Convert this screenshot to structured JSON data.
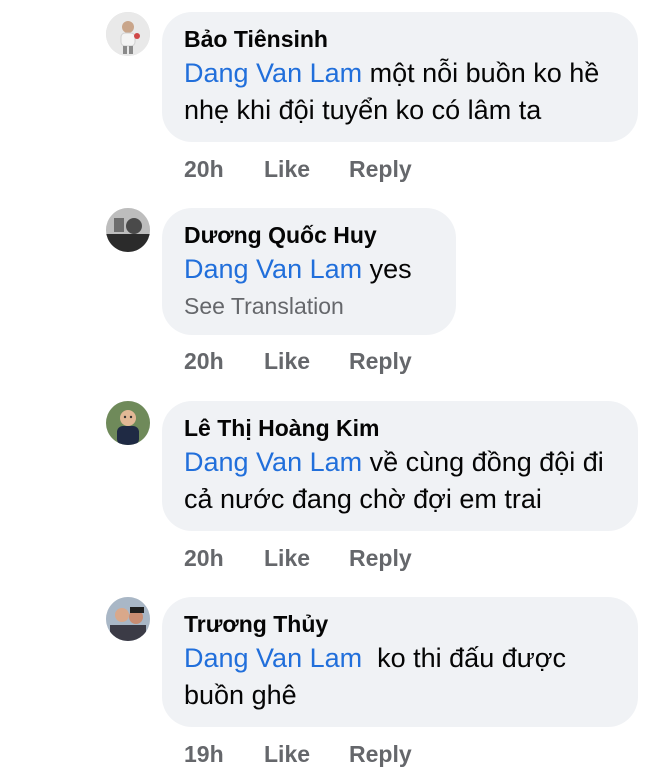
{
  "comments": [
    {
      "author": "Bảo Tiênsinh",
      "mention": "Dang Van Lam",
      "text": " một nỗi buồn ko hề nhẹ khi đội tuyển ko có lâm ta",
      "see_translation": "",
      "time": "20h",
      "like": "Like",
      "reply": "Reply"
    },
    {
      "author": "Dương Quốc Huy",
      "mention": "Dang Van Lam",
      "text": " yes",
      "see_translation": "See Translation",
      "time": "20h",
      "like": "Like",
      "reply": "Reply"
    },
    {
      "author": "Lê Thị Hoàng Kim",
      "mention": "Dang Van Lam",
      "text": " về cùng đồng đội đi cả nước đang chờ đợi em trai",
      "see_translation": "",
      "time": "20h",
      "like": "Like",
      "reply": "Reply"
    },
    {
      "author": "Trương Thủy",
      "mention": "Dang Van Lam",
      "text": "  ko thi đấu được buồn ghê",
      "see_translation": "",
      "time": "19h",
      "like": "Like",
      "reply": "Reply"
    }
  ],
  "colors": {
    "mention": "#216fdb",
    "bubble": "#f0f2f5",
    "meta": "#65676b"
  }
}
